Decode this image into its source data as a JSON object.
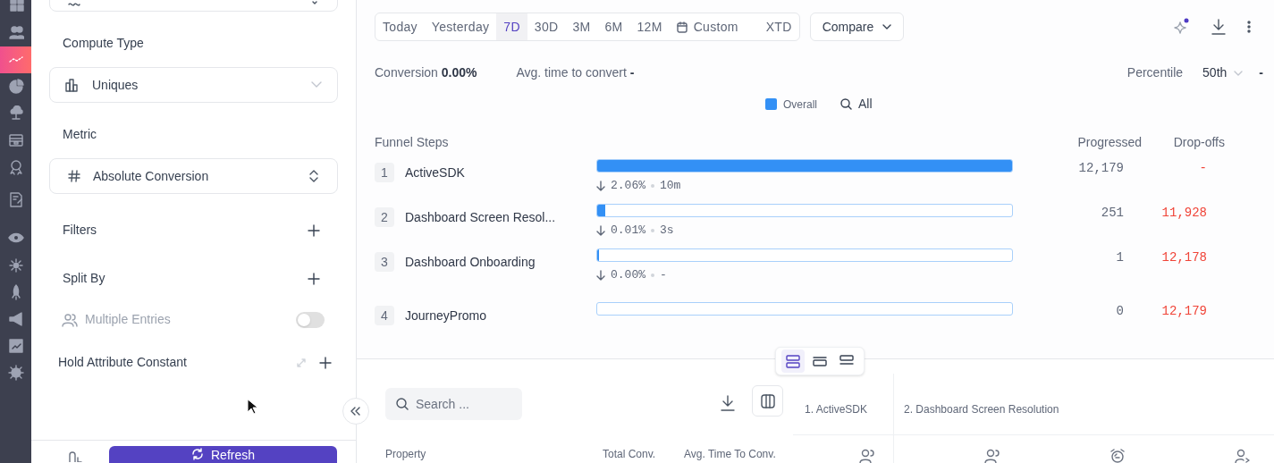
{
  "nav_items": [
    {
      "selected": false
    },
    {
      "selected": false
    },
    {
      "selected": true
    },
    {
      "selected": false
    },
    {
      "selected": false
    },
    {
      "selected": false
    },
    {
      "selected": false
    },
    {
      "selected": false
    },
    {
      "selected": false
    },
    {
      "selected": false
    },
    {
      "selected": false
    },
    {
      "selected": false
    },
    {
      "selected": false
    },
    {
      "selected": false
    }
  ],
  "config_panel": {
    "compute_type": {
      "label": "Compute Type",
      "value": "Uniques"
    },
    "metric": {
      "label": "Metric",
      "value": "Absolute Conversion"
    },
    "filters": {
      "label": "Filters"
    },
    "split_by": {
      "label": "Split By"
    },
    "multiple_entries": {
      "label": "Multiple Entries",
      "on": false
    },
    "hold_attribute_constant": {
      "label": "Hold Attribute Constant"
    },
    "refresh_button": "Refresh"
  },
  "date_ranges": [
    {
      "label": "Today",
      "selected": false,
      "kind": "preset"
    },
    {
      "label": "Yesterday",
      "selected": false,
      "kind": "preset"
    },
    {
      "label": "7D",
      "selected": true,
      "kind": "preset"
    },
    {
      "label": "30D",
      "selected": false,
      "kind": "preset"
    },
    {
      "label": "3M",
      "selected": false,
      "kind": "preset"
    },
    {
      "label": "6M",
      "selected": false,
      "kind": "preset"
    },
    {
      "label": "12M",
      "selected": false,
      "kind": "preset"
    },
    {
      "label": "Custom",
      "selected": false,
      "kind": "calendar"
    },
    {
      "label": "XTD",
      "selected": false,
      "kind": "preset"
    }
  ],
  "compare_button": "Compare",
  "summary": {
    "conversion_label": "Conversion",
    "conversion_value": "0.00%",
    "avg_time_label": "Avg. time to convert",
    "avg_time_value": "-",
    "percentile_label": "Percentile",
    "percentile_value": "50th",
    "percentile_reading": "-"
  },
  "legend": {
    "series": "Overall",
    "filter": "All"
  },
  "funnel": {
    "columns": [
      "Funnel Steps",
      "Progressed",
      "Drop-offs"
    ],
    "steps": [
      {
        "number": "1",
        "name": "ActiveSDK",
        "level": 1,
        "conversion": "2.06%",
        "time": "10m",
        "progressed": "12,179",
        "dropoffs": "-"
      },
      {
        "number": "2",
        "name": "Dashboard Screen Resol...",
        "level": 0.02,
        "conversion": "0.01%",
        "time": "3s",
        "progressed": "251",
        "dropoffs": "11,928"
      },
      {
        "number": "3",
        "name": "Dashboard Onboarding",
        "level": 0.005,
        "conversion": "0.00%",
        "time": "-",
        "progressed": "1",
        "dropoffs": "12,178"
      },
      {
        "number": "4",
        "name": "JourneyPromo",
        "level": 0,
        "progressed": "0",
        "dropoffs": "12,179"
      }
    ]
  },
  "view_toggles": [
    {
      "selected": true
    },
    {
      "selected": false
    },
    {
      "selected": false
    }
  ],
  "table": {
    "search_placeholder": "Search ...",
    "columns": [
      "Property",
      "Total Conv.",
      "Avg. Time To Conv."
    ],
    "step_columns": [
      "1. ActiveSDK",
      "2. Dashboard Screen Resolution"
    ]
  }
}
